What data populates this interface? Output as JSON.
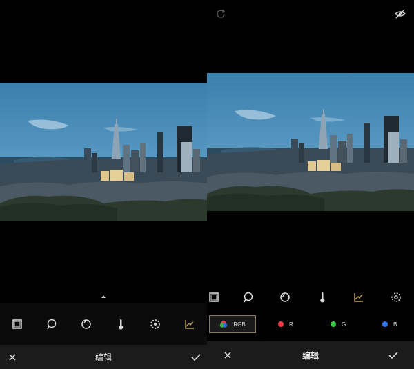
{
  "left_screen": {
    "bottom_bar": {
      "title": "编辑"
    },
    "tools": [
      "crop-icon",
      "lasso-icon",
      "tone-icon",
      "thermometer-icon",
      "focus-icon",
      "curves-icon"
    ]
  },
  "right_screen": {
    "top_bar": {
      "icons": [
        "redo-icon",
        "eye-off-icon"
      ]
    },
    "tools": [
      "crop-icon",
      "lasso-icon",
      "tone-icon",
      "thermometer-icon",
      "curves-icon",
      "settings-icon"
    ],
    "channels": [
      {
        "id": "rgb",
        "label": "RGB",
        "selected": true
      },
      {
        "id": "r",
        "label": "R",
        "color": "#e23b45"
      },
      {
        "id": "g",
        "label": "G",
        "color": "#3ec54a"
      },
      {
        "id": "b",
        "label": "B",
        "color": "#2e73e6"
      }
    ],
    "bottom_bar": {
      "title": "编辑"
    }
  },
  "colors": {
    "accent": "#b79a5a",
    "icon": "#dddddd",
    "bar": "#1b1b1b"
  }
}
